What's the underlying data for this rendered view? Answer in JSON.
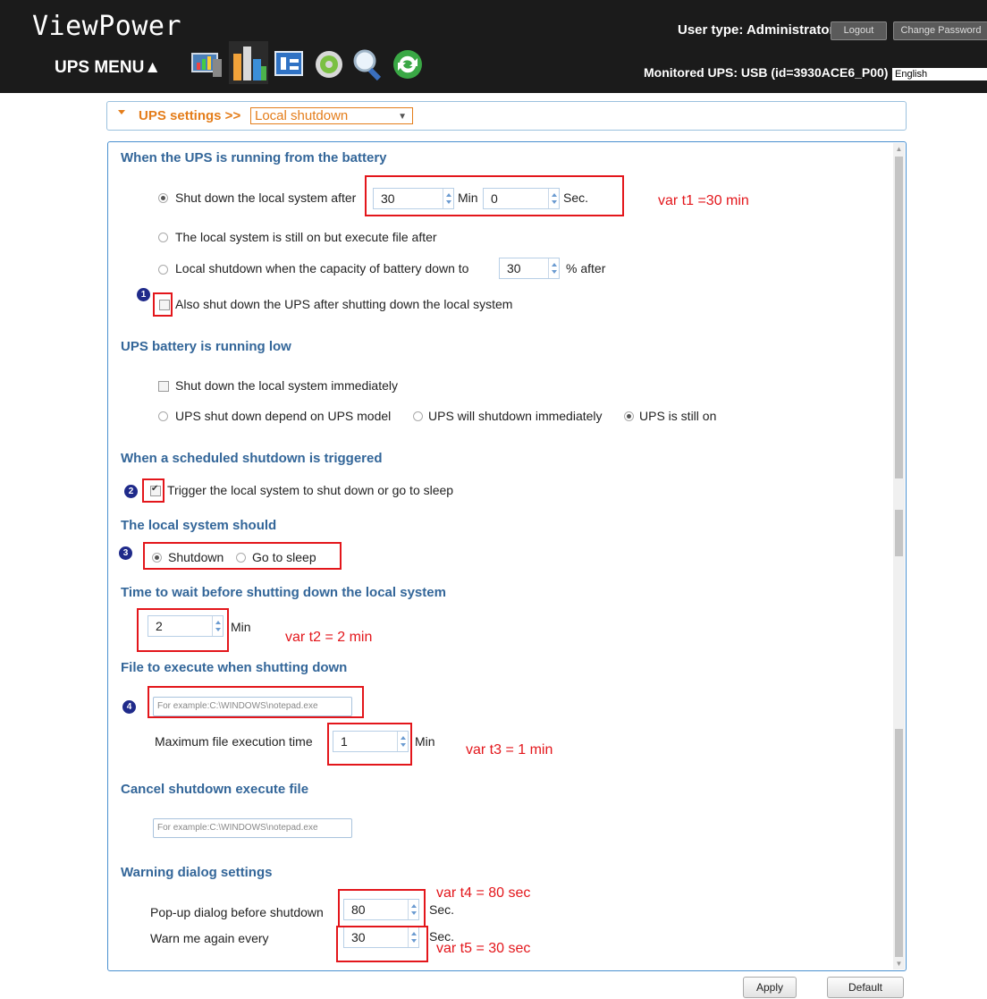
{
  "app": {
    "title": "ViewPower",
    "menu_label": "UPS MENU▲",
    "toolbar_icons": [
      "monitor-chart-icon",
      "bar-chart-icon",
      "config-tools-icon",
      "gear-icon",
      "search-icon",
      "refresh-icon"
    ]
  },
  "header": {
    "user_type": "User type: Administrator",
    "logout": "Logout",
    "change_password": "Change Password",
    "monitored": "Monitored UPS: USB (id=3930ACE6_P00)",
    "language": "English"
  },
  "breadcrumb": {
    "section": "UPS settings >>",
    "page": "Local shutdown"
  },
  "battery": {
    "heading": "When the UPS is running from the battery",
    "opt_shutdown_after": "Shut down the local system after",
    "min_value": "30",
    "min_label": "Min",
    "sec_value": "0",
    "sec_label": "Sec.",
    "opt_execute_file": "The local system is still on but execute file after",
    "opt_capacity": "Local shutdown when the capacity of battery down to",
    "capacity_value": "30",
    "capacity_suffix": "% after",
    "also_shutdown_ups": "Also shut down the UPS after shutting down the local system"
  },
  "low_battery": {
    "heading": "UPS battery is running low",
    "shutdown_immediately": "Shut down the local system immediately",
    "opt_depend_model": "UPS shut down depend on UPS model",
    "opt_ups_immediately": "UPS will shutdown immediately",
    "opt_still_on": "UPS is still on"
  },
  "scheduled": {
    "heading": "When a scheduled shutdown is triggered",
    "trigger_label": "Trigger the local system to shut down or go to sleep"
  },
  "local_system": {
    "heading": "The local system should",
    "opt_shutdown": "Shutdown",
    "opt_sleep": "Go to sleep"
  },
  "wait": {
    "heading": "Time to wait before shutting down the local system",
    "value": "2",
    "unit": "Min"
  },
  "exec_file": {
    "heading": "File to execute when shutting down",
    "placeholder": "For example:C:\\WINDOWS\\notepad.exe",
    "max_time_label": "Maximum file execution time",
    "max_time_value": "1",
    "max_time_unit": "Min"
  },
  "cancel_file": {
    "heading": "Cancel shutdown execute file",
    "placeholder": "For example:C:\\WINDOWS\\notepad.exe"
  },
  "warning": {
    "heading": "Warning dialog settings",
    "popup_label": "Pop-up dialog before shutdown",
    "popup_value": "80",
    "popup_unit": "Sec.",
    "again_label": "Warn me again every",
    "again_value": "30",
    "again_unit": "Sec."
  },
  "annotations": {
    "t1": "var t1 =30 min",
    "t2": "var t2 = 2 min",
    "t3": "var t3 = 1 min",
    "t4": "var t4 = 80 sec",
    "t5": "var t5 = 30 sec",
    "badges": [
      "1",
      "2",
      "3",
      "4"
    ]
  },
  "buttons": {
    "apply": "Apply",
    "default": "Default"
  },
  "colors": {
    "header_bg": "#1b1b1b",
    "heading": "#336699",
    "accent": "#e47d1a",
    "annotation_red": "#e3161b",
    "panel_border": "#4a90d0"
  }
}
